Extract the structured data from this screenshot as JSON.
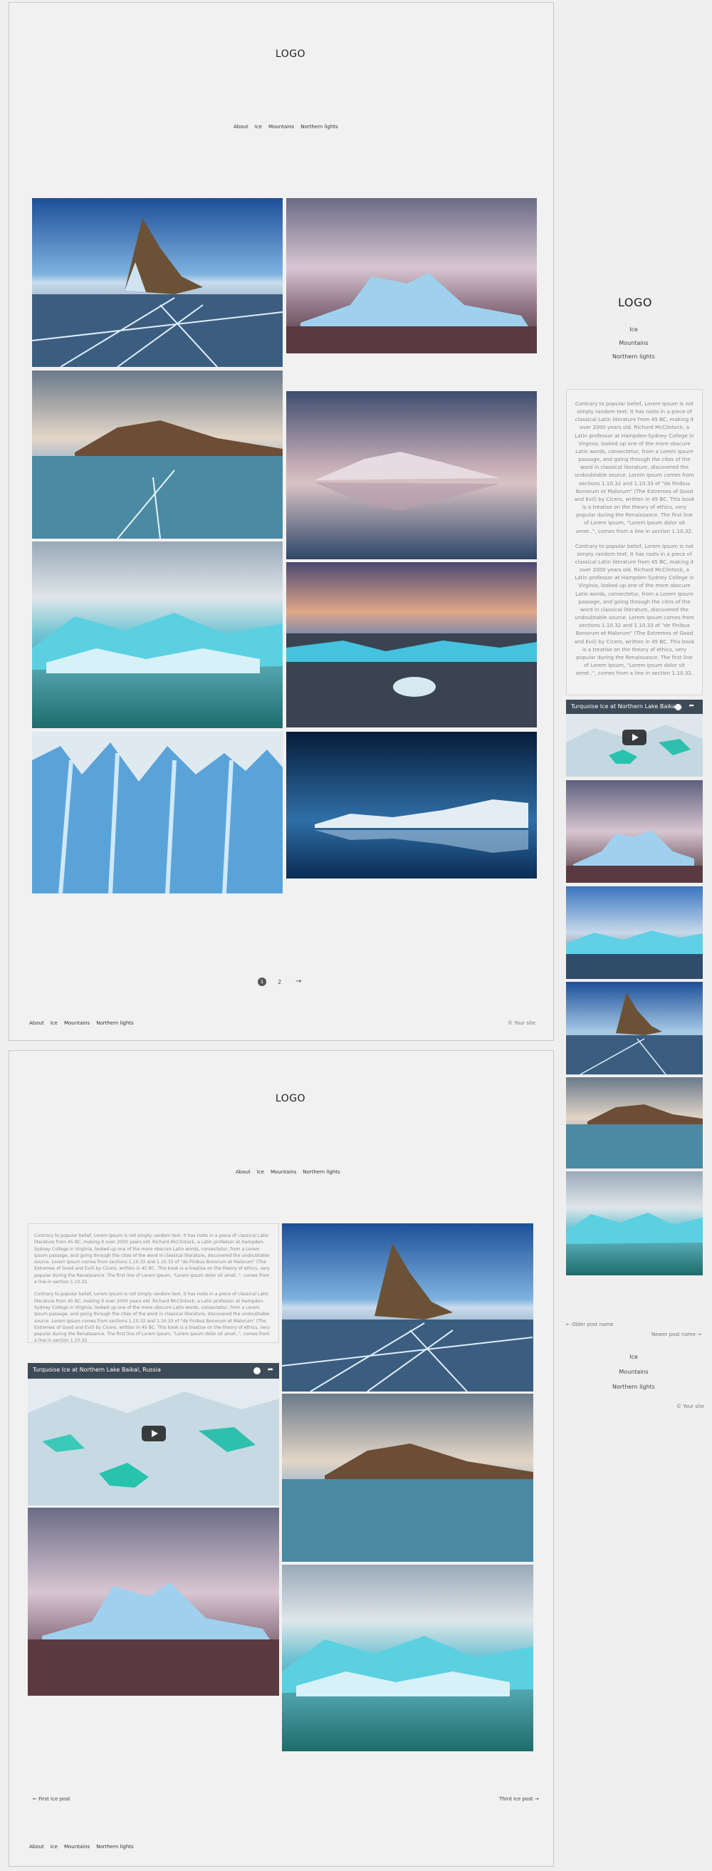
{
  "header": {
    "logo": "LOGO"
  },
  "nav": [
    {
      "label": "About"
    },
    {
      "label": "Ice"
    },
    {
      "label": "Mountains"
    },
    {
      "label": "Northern lights"
    }
  ],
  "pagination": {
    "page1": "1",
    "page2": "2",
    "next": "→"
  },
  "footer": {
    "copyright": "© Your site"
  },
  "sidebar": {
    "logo": "LOGO",
    "links": [
      {
        "label": "Ice"
      },
      {
        "label": "Mountains"
      },
      {
        "label": "Northern lights"
      }
    ],
    "paragraph1": "Contrary to popular belief, Lorem Ipsum is not simply random text. It has roots in a piece of classical Latin literature from 45 BC, making it over 2000 years old. Richard McClintock, a Latin professor at Hampden-Sydney College in Virginia, looked up one of the more obscure Latin words, consectetur, from a Lorem Ipsum passage, and going through the cites of the word in classical literature, discovered the undoubtable source. Lorem Ipsum comes from sections 1.10.32 and 1.10.33 of \"de Finibus Bonorum et Malorum\" (The Extremes of Good and Evil) by Cicero, written in 45 BC. This book is a treatise on the theory of ethics, very popular during the Renaissance. The first line of Lorem Ipsum, \"Lorem ipsum dolor sit amet..\", comes from a line in section 1.10.32.",
    "paragraph2": "Contrary to popular belief, Lorem Ipsum is not simply random text. It has roots in a piece of classical Latin literature from 45 BC, making it over 2000 years old. Richard McClintock, a Latin professor at Hampden-Sydney College in Virginia, looked up one of the more obscure Latin words, consectetur, from a Lorem Ipsum passage, and going through the cites of the word in classical literature, discovered the undoubtable source. Lorem Ipsum comes from sections 1.10.32 and 1.10.33 of \"de Finibus Bonorum et Malorum\" (The Extremes of Good and Evil) by Cicero, written in 45 BC. This book is a treatise on the theory of ethics, very popular during the Renaissance. The first line of Lorem Ipsum, \"Lorem ipsum dolor sit amet..\", comes from a line in section 1.10.32.",
    "video_title": "Turquoise Ice at Northern Lake Baikal...",
    "older_post": "← Older post name",
    "newer_post": "Newer post name →",
    "links_bottom": [
      {
        "label": "Ice"
      },
      {
        "label": "Mountains"
      },
      {
        "label": "Northern lights"
      }
    ],
    "copyright": "© Your site"
  },
  "post": {
    "logo": "LOGO",
    "video_title": "Turquoise Ice at Northern Lake Baikal, Russia",
    "prev_post": "← First Ice post",
    "next_post": "Third Ice post →"
  },
  "colors": {
    "sky_blue": "#3f79b5",
    "ice_teal": "#3fb7c7",
    "panel_bg": "#f1f1f1",
    "border": "#c8c8c8"
  }
}
